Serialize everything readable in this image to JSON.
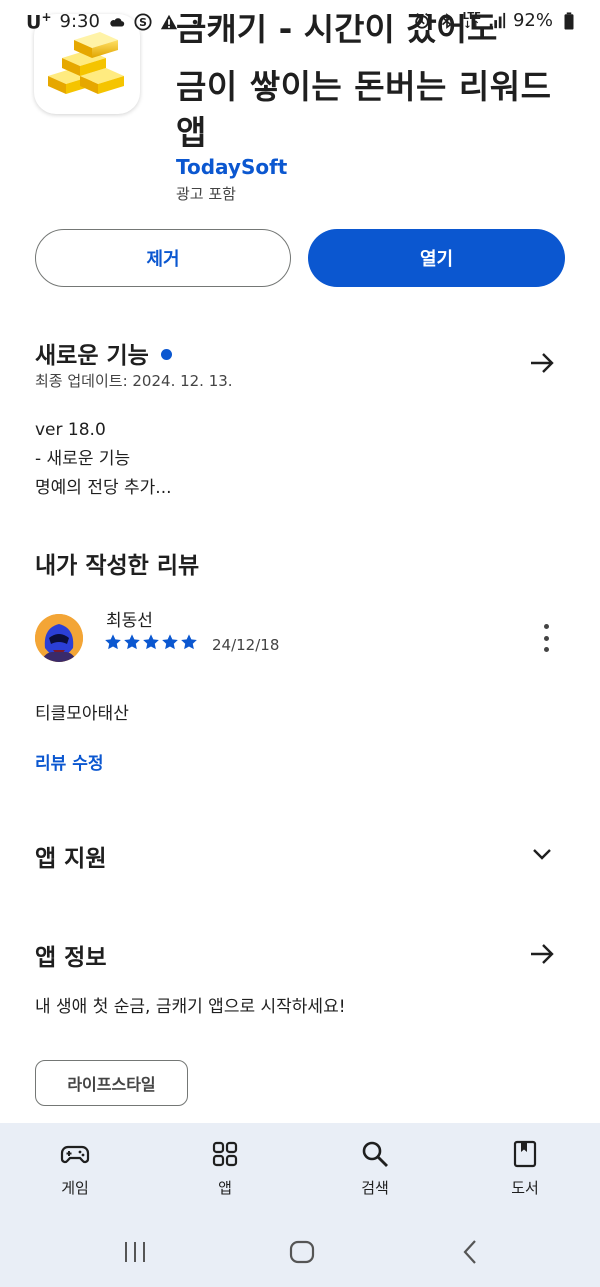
{
  "status_bar": {
    "carrier": "U",
    "carrier_sup": "+",
    "time": "9:30",
    "lte": "LTE",
    "battery": "92%"
  },
  "app": {
    "title_partial": "금캐기 - 시간이 갔어도",
    "title_line2": "금이 쌓이는 돈버는 리워드",
    "title_line3": "앱",
    "developer": "TodaySoft",
    "ads_label": "광고 포함"
  },
  "actions": {
    "remove_label": "제거",
    "open_label": "열기"
  },
  "whats_new": {
    "title": "새로운 기능",
    "updated": "최종 업데이트: 2024. 12. 13.",
    "lines": [
      "ver 18.0",
      "- 새로운 기능",
      "명예의 전당 추가..."
    ]
  },
  "my_review": {
    "title": "내가 작성한 리뷰",
    "reviewer": "최동선",
    "rating": 5,
    "date": "24/12/18",
    "text": "티클모아태산",
    "edit_label": "리뷰 수정"
  },
  "app_support": {
    "title": "앱 지원"
  },
  "app_info": {
    "title": "앱 정보",
    "description": "내 생애 첫 순금, 금캐기 앱으로 시작하세요!",
    "category_chip": "라이프스타일"
  },
  "bottom_nav": {
    "items": [
      {
        "label": "게임",
        "icon": "gamepad-icon"
      },
      {
        "label": "앱",
        "icon": "apps-grid-icon"
      },
      {
        "label": "검색",
        "icon": "search-icon"
      },
      {
        "label": "도서",
        "icon": "book-icon"
      }
    ]
  },
  "colors": {
    "accent": "#0b57d0",
    "nav_bg": "#e9eef6",
    "star": "#0b57d0"
  }
}
